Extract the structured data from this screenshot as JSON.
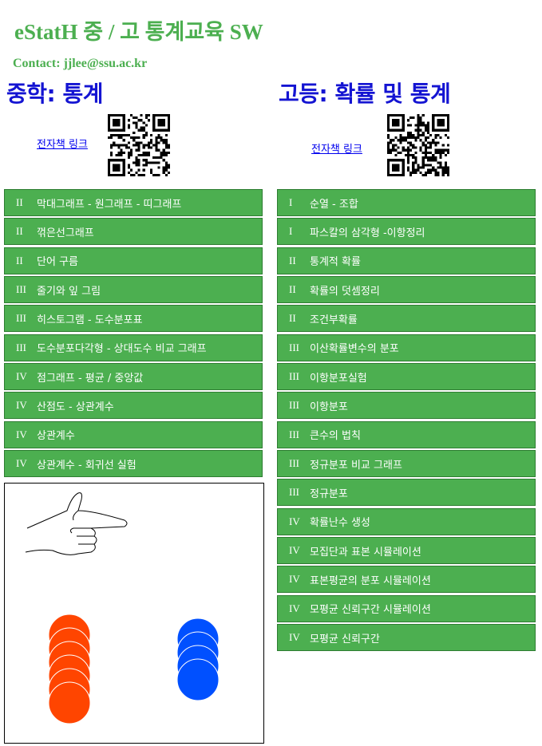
{
  "header": {
    "title": "eStatH 중 / 고 통계교육 SW",
    "contact": "Contact: jjlee@ssu.ac.kr"
  },
  "middle": {
    "title": "중학: 통계",
    "ebook_link": "전자책 링크",
    "menu": [
      {
        "num": "II",
        "label": "막대그래프 - 원그래프 - 띠그래프"
      },
      {
        "num": "II",
        "label": "꺾은선그래프"
      },
      {
        "num": "II",
        "label": "단어 구름"
      },
      {
        "num": "III",
        "label": "줄기와 잎 그림"
      },
      {
        "num": "III",
        "label": "히스토그램 - 도수분포표"
      },
      {
        "num": "III",
        "label": "도수분포다각형 - 상대도수 비교 그래프"
      },
      {
        "num": "IV",
        "label": "점그래프 - 평균 / 중앙값"
      },
      {
        "num": "IV",
        "label": "산점도 - 상관계수"
      },
      {
        "num": "IV",
        "label": "상관계수"
      },
      {
        "num": "IV",
        "label": "상관계수 - 회귀선 실험"
      }
    ]
  },
  "high": {
    "title": "고등: 확률 및 통계",
    "ebook_link": "전자책 링크",
    "menu": [
      {
        "num": "I",
        "label": "순열 - 조합"
      },
      {
        "num": "I",
        "label": "파스칼의 삼각형 -이항정리"
      },
      {
        "num": "II",
        "label": "통계적 확률"
      },
      {
        "num": "II",
        "label": "확률의 덧셈정리"
      },
      {
        "num": "II",
        "label": "조건부확률"
      },
      {
        "num": "III",
        "label": "이산확률변수의 분포"
      },
      {
        "num": "III",
        "label": "이항분포실험"
      },
      {
        "num": "III",
        "label": "이항분포"
      },
      {
        "num": "III",
        "label": "큰수의 법칙"
      },
      {
        "num": "III",
        "label": "정규분포 비교 그래프"
      },
      {
        "num": "III",
        "label": "정규분포"
      },
      {
        "num": "IV",
        "label": "확률난수 생성"
      },
      {
        "num": "IV",
        "label": "모집단과 표본 시뮬레이션"
      },
      {
        "num": "IV",
        "label": "표본평균의 분포 시뮬레이션"
      },
      {
        "num": "IV",
        "label": "모평균 신뢰구간 시뮬레이션"
      },
      {
        "num": "IV",
        "label": "모평균 신뢰구간"
      }
    ]
  },
  "simulation": {
    "icon": "pointing-hand-icon",
    "red_coins": 6,
    "blue_coins": 4,
    "red_color": "#ff4500",
    "blue_color": "#0050ff"
  },
  "colors": {
    "brand_green": "#4caf50",
    "heading_blue": "#1414d2",
    "link_blue": "#0000ee"
  }
}
